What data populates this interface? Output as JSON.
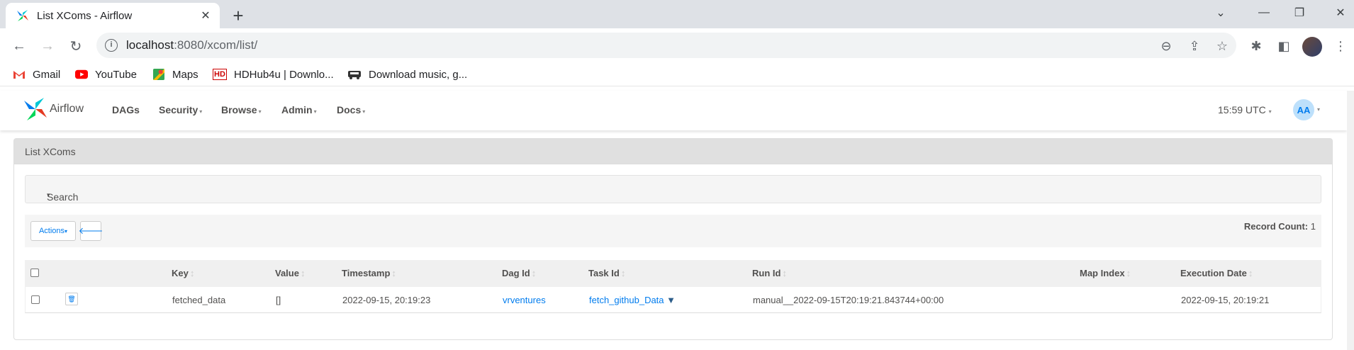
{
  "browser": {
    "tab_title": "List XComs - Airflow",
    "url_host": "localhost",
    "url_rest": ":8080/xcom/list/",
    "bookmarks": [
      {
        "label": "Gmail",
        "icon": "gmail-icon"
      },
      {
        "label": "YouTube",
        "icon": "youtube-icon"
      },
      {
        "label": "Maps",
        "icon": "maps-icon"
      },
      {
        "label": "HDHub4u | Downlo...",
        "icon": "hd-icon"
      },
      {
        "label": "Download music, g...",
        "icon": "car-icon"
      }
    ]
  },
  "navbar": {
    "brand": "Airflow",
    "items": [
      "DAGs",
      "Security",
      "Browse",
      "Admin",
      "Docs"
    ],
    "time": "15:59 UTC",
    "user_initials": "AA"
  },
  "panel": {
    "title": "List XComs",
    "search_label": "Search",
    "actions_label": "Actions",
    "record_count_label": "Record Count:",
    "record_count": "1"
  },
  "table": {
    "headers": [
      "Key",
      "Value",
      "Timestamp",
      "Dag Id",
      "Task Id",
      "Run Id",
      "Map Index",
      "Execution Date"
    ],
    "rows": [
      {
        "key": "fetched_data",
        "value": "[]",
        "timestamp": "2022-09-15, 20:19:23",
        "dag_id": "vrventures",
        "task_id": "fetch_github_Data",
        "run_id": "manual__2022-09-15T20:19:21.843744+00:00",
        "map_index": "",
        "execution_date": "2022-09-15, 20:19:21"
      }
    ]
  },
  "colors": {
    "accent": "#017cee",
    "text": "#51504f",
    "heading_bg": "#e0e0e0"
  }
}
